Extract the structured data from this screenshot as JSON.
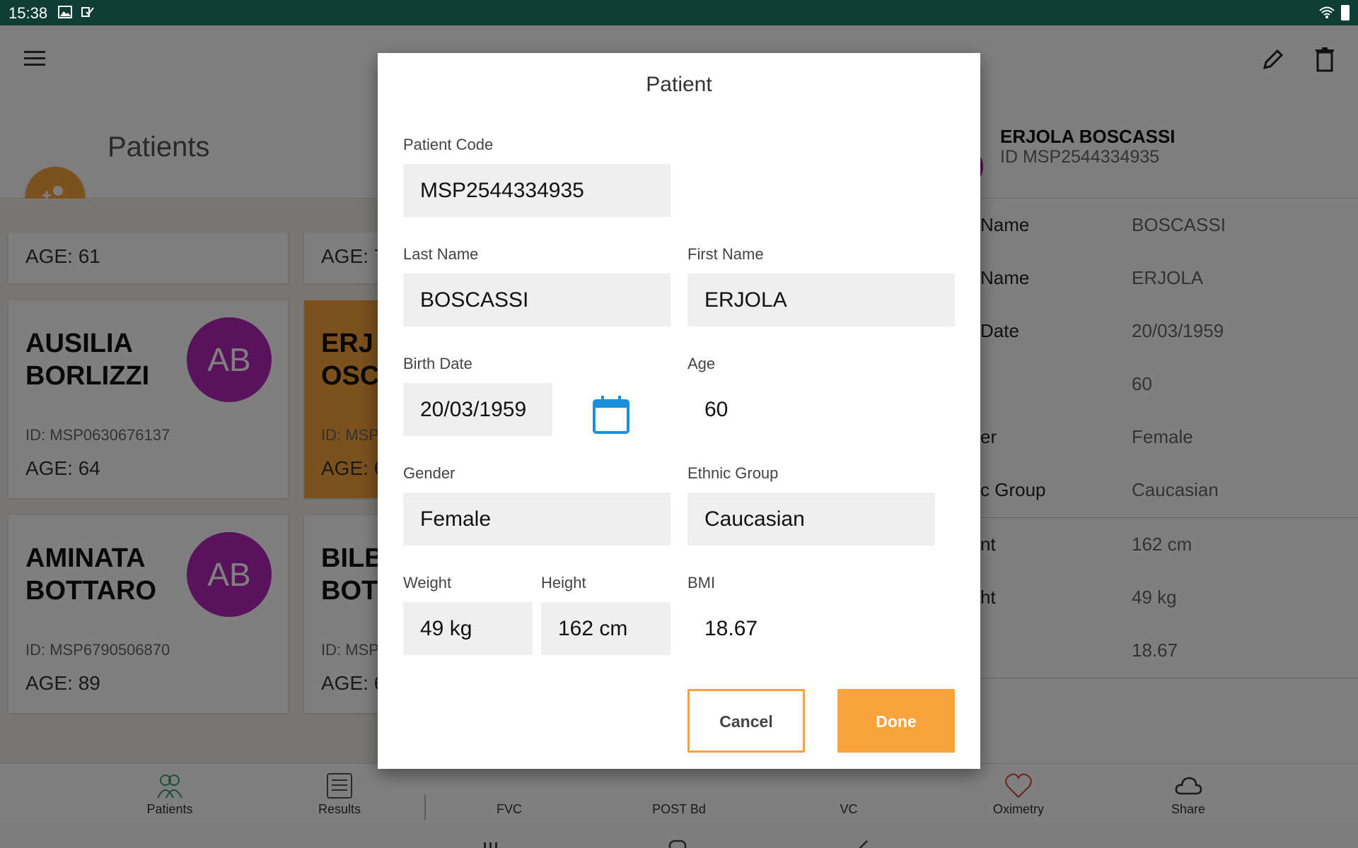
{
  "status_bar": {
    "time": "15:38"
  },
  "app": {
    "section_title": "Patients",
    "patient_header": {
      "name": "ERJOLA BOSCASSI",
      "id": "ID MSP2544334935"
    },
    "cards": [
      {
        "age": "AGE: 61"
      },
      {
        "age": "AGE: 7"
      },
      {
        "name_line1": "AUSILIA",
        "name_line2": "BORLIZZI",
        "initials": "AB",
        "id": "ID: MSP0630676137",
        "age": "AGE: 64"
      },
      {
        "name_line1": "ERJ",
        "name_line2": "OSC",
        "id": "ID: MSP",
        "age": "AGE: 6"
      },
      {
        "name_line1": "AMINATA",
        "name_line2": "BOTTARO",
        "initials": "AB",
        "id": "ID: MSP6790506870",
        "age": "AGE: 89"
      },
      {
        "name_line1": "BILB",
        "name_line2": "BOT",
        "id": "ID: MSP",
        "age": "AGE: 6"
      }
    ],
    "detail_rows": [
      {
        "label": "Name",
        "value": "BOSCASSI"
      },
      {
        "label": "Name",
        "value": "ERJOLA"
      },
      {
        "label": "Date",
        "value": "20/03/1959"
      },
      {
        "label": "",
        "value": "60"
      },
      {
        "label": "er",
        "value": "Female"
      },
      {
        "label": "c Group",
        "value": "Caucasian"
      },
      {
        "label": "nt",
        "value": "162 cm"
      },
      {
        "label": "ht",
        "value": "49 kg"
      },
      {
        "label": "",
        "value": "18.67"
      }
    ],
    "nav": [
      {
        "label": "Patients",
        "icon": "people-icon",
        "color": "#3a9a6e"
      },
      {
        "label": "Results",
        "icon": "list-icon",
        "color": "#555555"
      },
      {
        "label": "FVC",
        "icon": "fvc-icon",
        "color": "#555555"
      },
      {
        "label": "POST Bd",
        "icon": "post-bd-icon",
        "color": "#555555"
      },
      {
        "label": "VC",
        "icon": "vc-icon",
        "color": "#555555"
      },
      {
        "label": "Oximetry",
        "icon": "heart-icon",
        "color": "#e0453a"
      },
      {
        "label": "Share",
        "icon": "cloud-icon",
        "color": "#333333"
      }
    ]
  },
  "dialog": {
    "title": "Patient",
    "patient_code": {
      "label": "Patient Code",
      "value": "MSP2544334935"
    },
    "last_name": {
      "label": "Last Name",
      "value": "BOSCASSI"
    },
    "first_name": {
      "label": "First Name",
      "value": "ERJOLA"
    },
    "birth_date": {
      "label": "Birth Date",
      "value": "20/03/1959"
    },
    "age": {
      "label": "Age",
      "value": "60"
    },
    "gender": {
      "label": "Gender",
      "value": "Female"
    },
    "ethnic_group": {
      "label": "Ethnic Group",
      "value": "Caucasian"
    },
    "weight": {
      "label": "Weight",
      "value": "49 kg"
    },
    "height": {
      "label": "Height",
      "value": "162 cm"
    },
    "bmi": {
      "label": "BMI",
      "value": "18.67"
    },
    "cancel_label": "Cancel",
    "done_label": "Done"
  },
  "colors": {
    "accent": "#f7a23a",
    "avatar": "#b224b8",
    "calendar": "#1a8fdc",
    "status_bar": "#0f3d33"
  }
}
